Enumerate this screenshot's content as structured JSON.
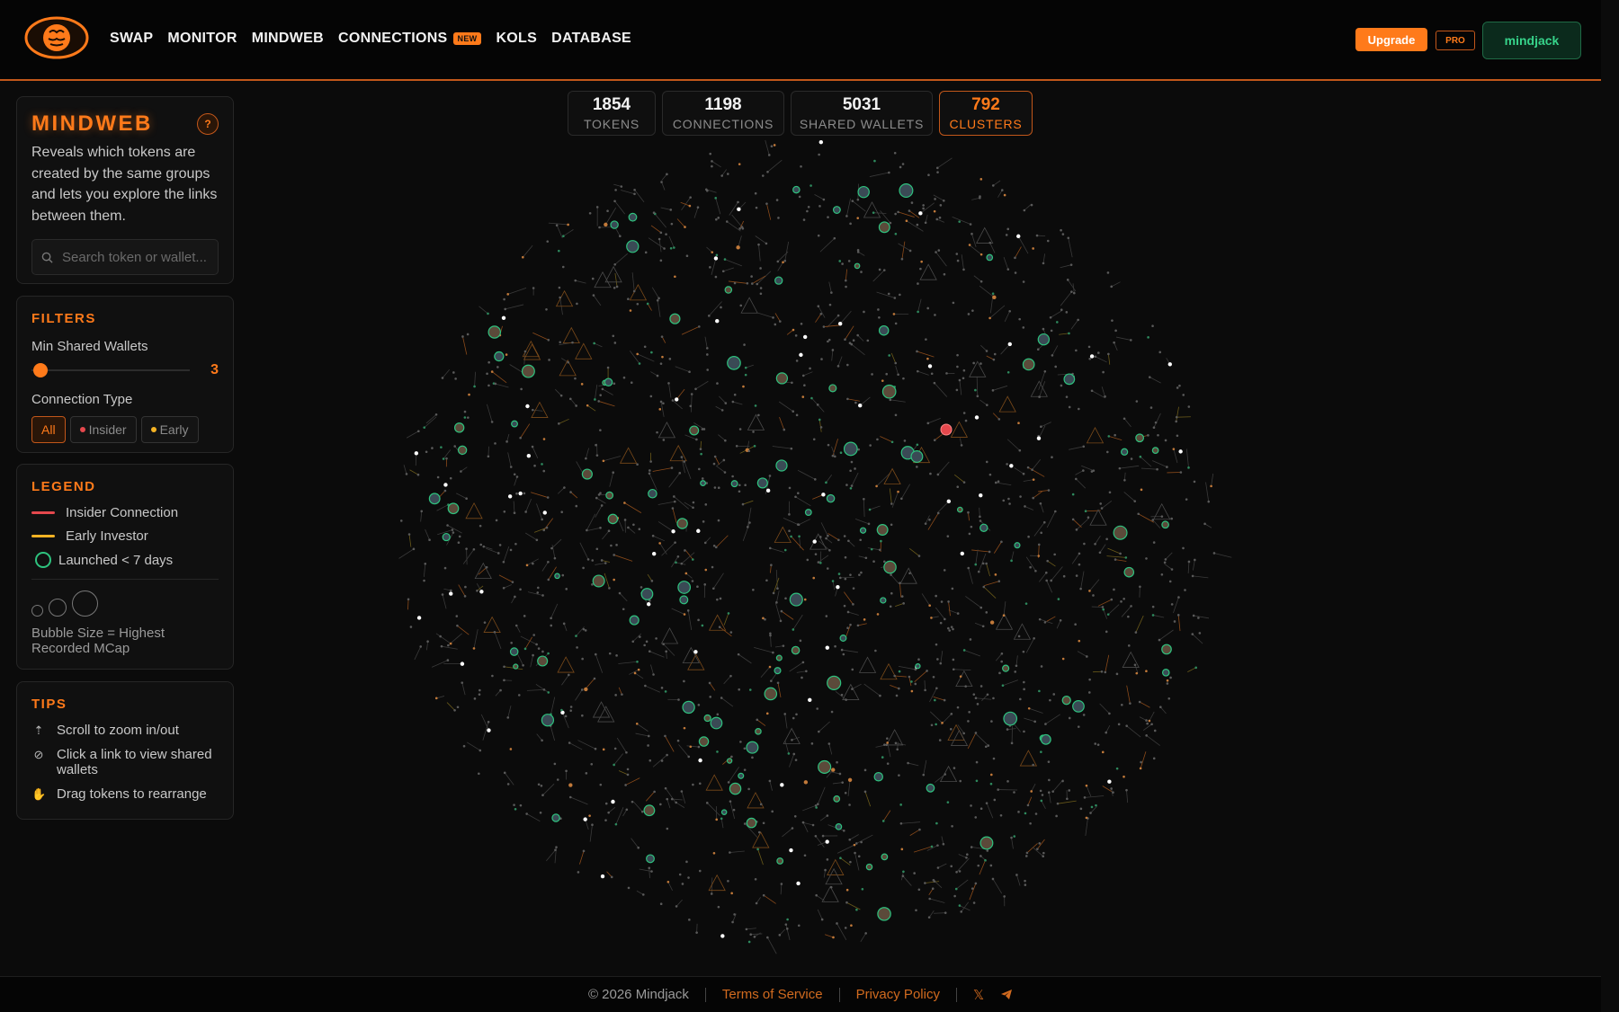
{
  "nav": {
    "items": [
      {
        "label": "SWAP"
      },
      {
        "label": "MONITOR"
      },
      {
        "label": "MINDWEB"
      },
      {
        "label": "CONNECTIONS",
        "badge": "NEW"
      },
      {
        "label": "KOLS"
      },
      {
        "label": "DATABASE"
      }
    ],
    "upgrade_label": "Upgrade",
    "pro_label": "PRO",
    "user_label": "mindjack"
  },
  "mindweb": {
    "title": "MINDWEB",
    "help_label": "?",
    "description": "Reveals which tokens are created by the same groups and lets you explore the links between them.",
    "search_placeholder": "Search token or wallet..."
  },
  "filters": {
    "title": "FILTERS",
    "min_shared_label": "Min Shared Wallets",
    "min_shared_value": "3",
    "connection_type_label": "Connection Type",
    "chips": [
      {
        "label": "All",
        "dot": null
      },
      {
        "label": "Insider",
        "dot": "#e5484d"
      },
      {
        "label": "Early",
        "dot": "#f5b324"
      }
    ]
  },
  "legend": {
    "title": "LEGEND",
    "insider": "Insider Connection",
    "early": "Early Investor",
    "launched": "Launched < 7 days",
    "bubble_note": "Bubble Size = Highest Recorded MCap",
    "colors": {
      "insider": "#e5484d",
      "early": "#f5b324",
      "launched": "#2ec27e"
    }
  },
  "tips": {
    "title": "TIPS",
    "items": [
      {
        "icon": "scroll-icon",
        "text": "Scroll to zoom in/out"
      },
      {
        "icon": "link-icon",
        "text": "Click a link to view shared wallets"
      },
      {
        "icon": "hand-icon",
        "text": "Drag tokens to rearrange"
      }
    ]
  },
  "stats": [
    {
      "value": "1854",
      "label": "TOKENS"
    },
    {
      "value": "1198",
      "label": "CONNECTIONS"
    },
    {
      "value": "5031",
      "label": "SHARED WALLETS"
    },
    {
      "value": "792",
      "label": "CLUSTERS"
    }
  ],
  "footer": {
    "copyright": "© 2026 Mindjack",
    "terms": "Terms of Service",
    "privacy": "Privacy Policy"
  },
  "colors": {
    "accent": "#ff7a1a",
    "background": "#0b0b0b",
    "green": "#2ec27e"
  }
}
